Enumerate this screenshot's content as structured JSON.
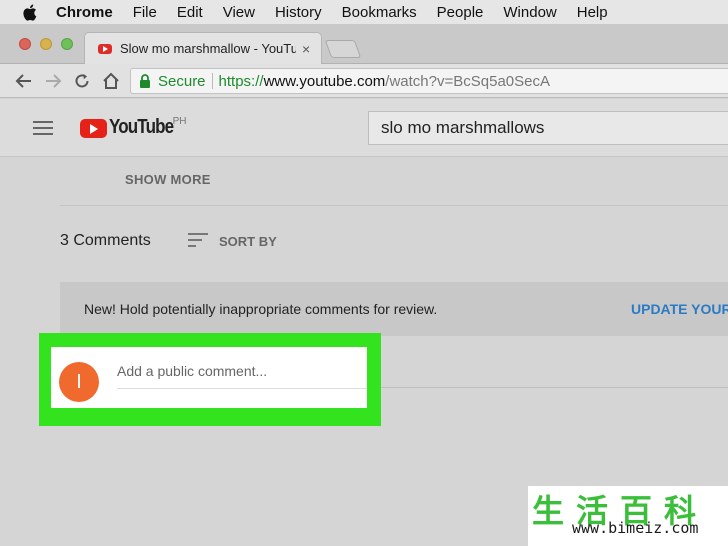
{
  "menubar": {
    "app": "Chrome",
    "items": [
      "File",
      "Edit",
      "View",
      "History",
      "Bookmarks",
      "People",
      "Window",
      "Help"
    ]
  },
  "tab": {
    "title": "Slow mo marshmallow - YouTube",
    "close": "×"
  },
  "omnibox": {
    "secure_label": "Secure",
    "url_scheme": "https://",
    "url_host": "www.youtube.com",
    "url_path": "/watch?v=BcSq5a0SecA"
  },
  "youtube": {
    "wordmark": "YouTube",
    "region": "PH",
    "search_value": "slo mo marshmallows"
  },
  "video": {
    "show_more": "SHOW MORE"
  },
  "comments": {
    "count_label": "3 Comments",
    "sort_label": "SORT BY",
    "notice_text": "New! Hold potentially inappropriate comments for review.",
    "notice_link": "UPDATE YOUR",
    "avatar_initial": "I",
    "input_placeholder": "Add a public comment..."
  },
  "watermark": {
    "chars": "生活百科",
    "url": "www.bimeiz.com"
  },
  "colors": {
    "highlight": "#33e31d",
    "avatar": "#ef6a2c",
    "secure_green": "#1f8a2d",
    "link_blue": "#2a7bc5",
    "youtube_red": "#e62117"
  }
}
